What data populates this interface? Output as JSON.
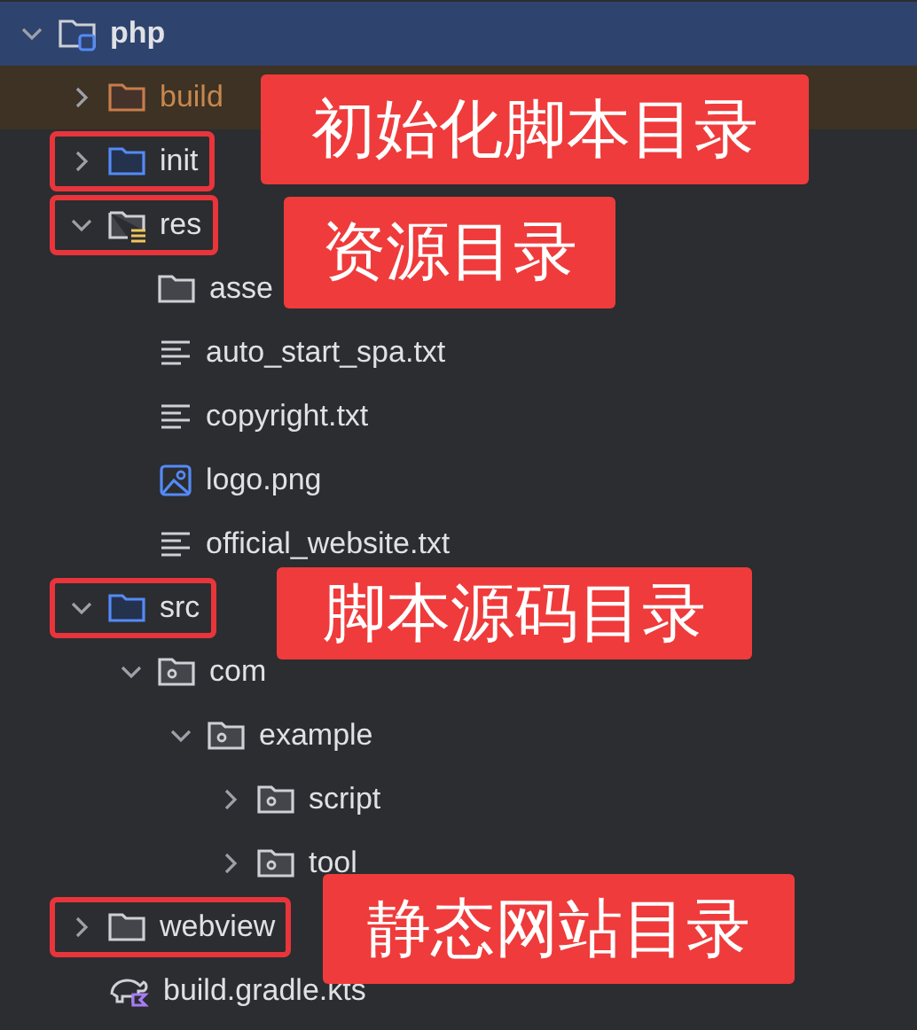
{
  "project_tree": [
    {
      "label": "php",
      "kind": "module",
      "expanded": true,
      "selected": true,
      "highlighted": false,
      "children": [
        {
          "label": "build",
          "kind": "excluded-folder",
          "expanded": false,
          "selected": false,
          "highlighted": false
        },
        {
          "label": "init",
          "kind": "source-folder",
          "expanded": false,
          "selected": false,
          "highlighted": true
        },
        {
          "label": "res",
          "kind": "resource-folder",
          "expanded": true,
          "selected": false,
          "highlighted": true,
          "children": [
            {
              "label": "asse",
              "kind": "folder",
              "selected": false,
              "highlighted": false
            },
            {
              "label": "auto_start_spa.txt",
              "kind": "text-file",
              "selected": false,
              "highlighted": false
            },
            {
              "label": "copyright.txt",
              "kind": "text-file",
              "selected": false,
              "highlighted": false
            },
            {
              "label": "logo.png",
              "kind": "image-file",
              "selected": false,
              "highlighted": false
            },
            {
              "label": "official_website.txt",
              "kind": "text-file",
              "selected": false,
              "highlighted": false
            }
          ]
        },
        {
          "label": "src",
          "kind": "source-folder",
          "expanded": true,
          "selected": false,
          "highlighted": true,
          "children": [
            {
              "label": "com",
              "kind": "package",
              "expanded": true,
              "selected": false,
              "highlighted": false,
              "children": [
                {
                  "label": "example",
                  "kind": "package",
                  "expanded": true,
                  "selected": false,
                  "highlighted": false,
                  "children": [
                    {
                      "label": "script",
                      "kind": "package",
                      "expanded": false,
                      "selected": false,
                      "highlighted": false
                    },
                    {
                      "label": "tool",
                      "kind": "package",
                      "expanded": false,
                      "selected": false,
                      "highlighted": false
                    }
                  ]
                }
              ]
            }
          ]
        },
        {
          "label": "webview",
          "kind": "folder",
          "expanded": false,
          "selected": false,
          "highlighted": true
        },
        {
          "label": "build.gradle.kts",
          "kind": "gradle-file",
          "selected": false,
          "highlighted": false
        }
      ]
    }
  ],
  "callouts": [
    {
      "text": "初始化脚本目录"
    },
    {
      "text": "资源目录"
    },
    {
      "text": "脚本源码目录"
    },
    {
      "text": "静态网站目录"
    }
  ]
}
